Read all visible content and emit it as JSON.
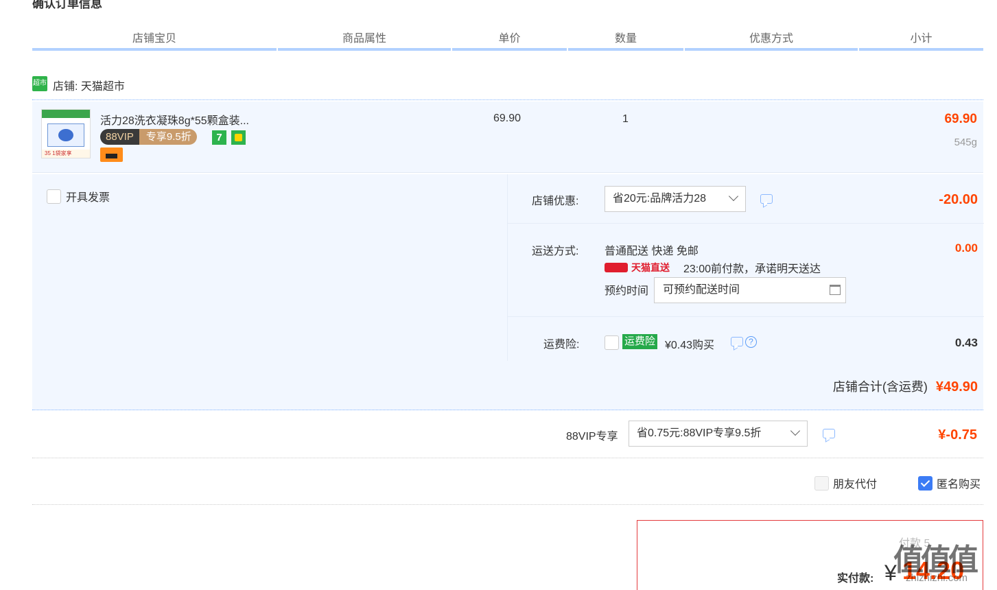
{
  "page": {
    "section_title": "确认订单信息"
  },
  "table_headers": [
    "店铺宝贝",
    "商品属性",
    "单价",
    "数量",
    "优惠方式",
    "小计"
  ],
  "store": {
    "label": "店铺: 天猫超市",
    "icon_text": "超市"
  },
  "item": {
    "title": "活力28洗衣凝珠8g*55颗盒装...",
    "vip_badge_left": "88VIP",
    "vip_badge_right": "专享9.5折",
    "badge_seven": "7",
    "thumb_footer": "35 1袋家享",
    "unit_price": "69.90",
    "quantity": "1",
    "subtotal": "69.90",
    "weight": "545g"
  },
  "invoice": {
    "label": "开具发票"
  },
  "store_discount": {
    "label": "店铺优惠:",
    "selected": "省20元:品牌活力28",
    "amount": "-20.00"
  },
  "shipping": {
    "label": "运送方式:",
    "method": "普通配送 快递 免邮",
    "tmall_direct": "天猫直送",
    "promise": "23:00前付款，承诺明天送达",
    "appointment_label": "预约时间",
    "appointment_placeholder": "可预约配送时间",
    "amount": "0.00"
  },
  "insurance": {
    "label": "运费险:",
    "tag": "运费险",
    "price_text": "¥0.43购买",
    "amount": "0.43"
  },
  "store_total": {
    "label": "店铺合计(含运费)",
    "amount": "¥49.90"
  },
  "vip": {
    "label": "88VIP专享",
    "selected": "省0.75元:88VIP专享9.5折",
    "amount": "¥-0.75"
  },
  "pay_options": {
    "friend_pay": "朋友代付",
    "anonymous": "匿名购买"
  },
  "payment": {
    "label": "实付款:",
    "currency": "¥",
    "amount": "14.20",
    "faded_text": "付款 5"
  },
  "watermark": {
    "main": "值值值",
    "sub": "zhizhizhi.com"
  },
  "colors": {
    "price_red": "#ff4400",
    "accent_blue": "#b2d1ff",
    "green": "#2eb34e"
  }
}
